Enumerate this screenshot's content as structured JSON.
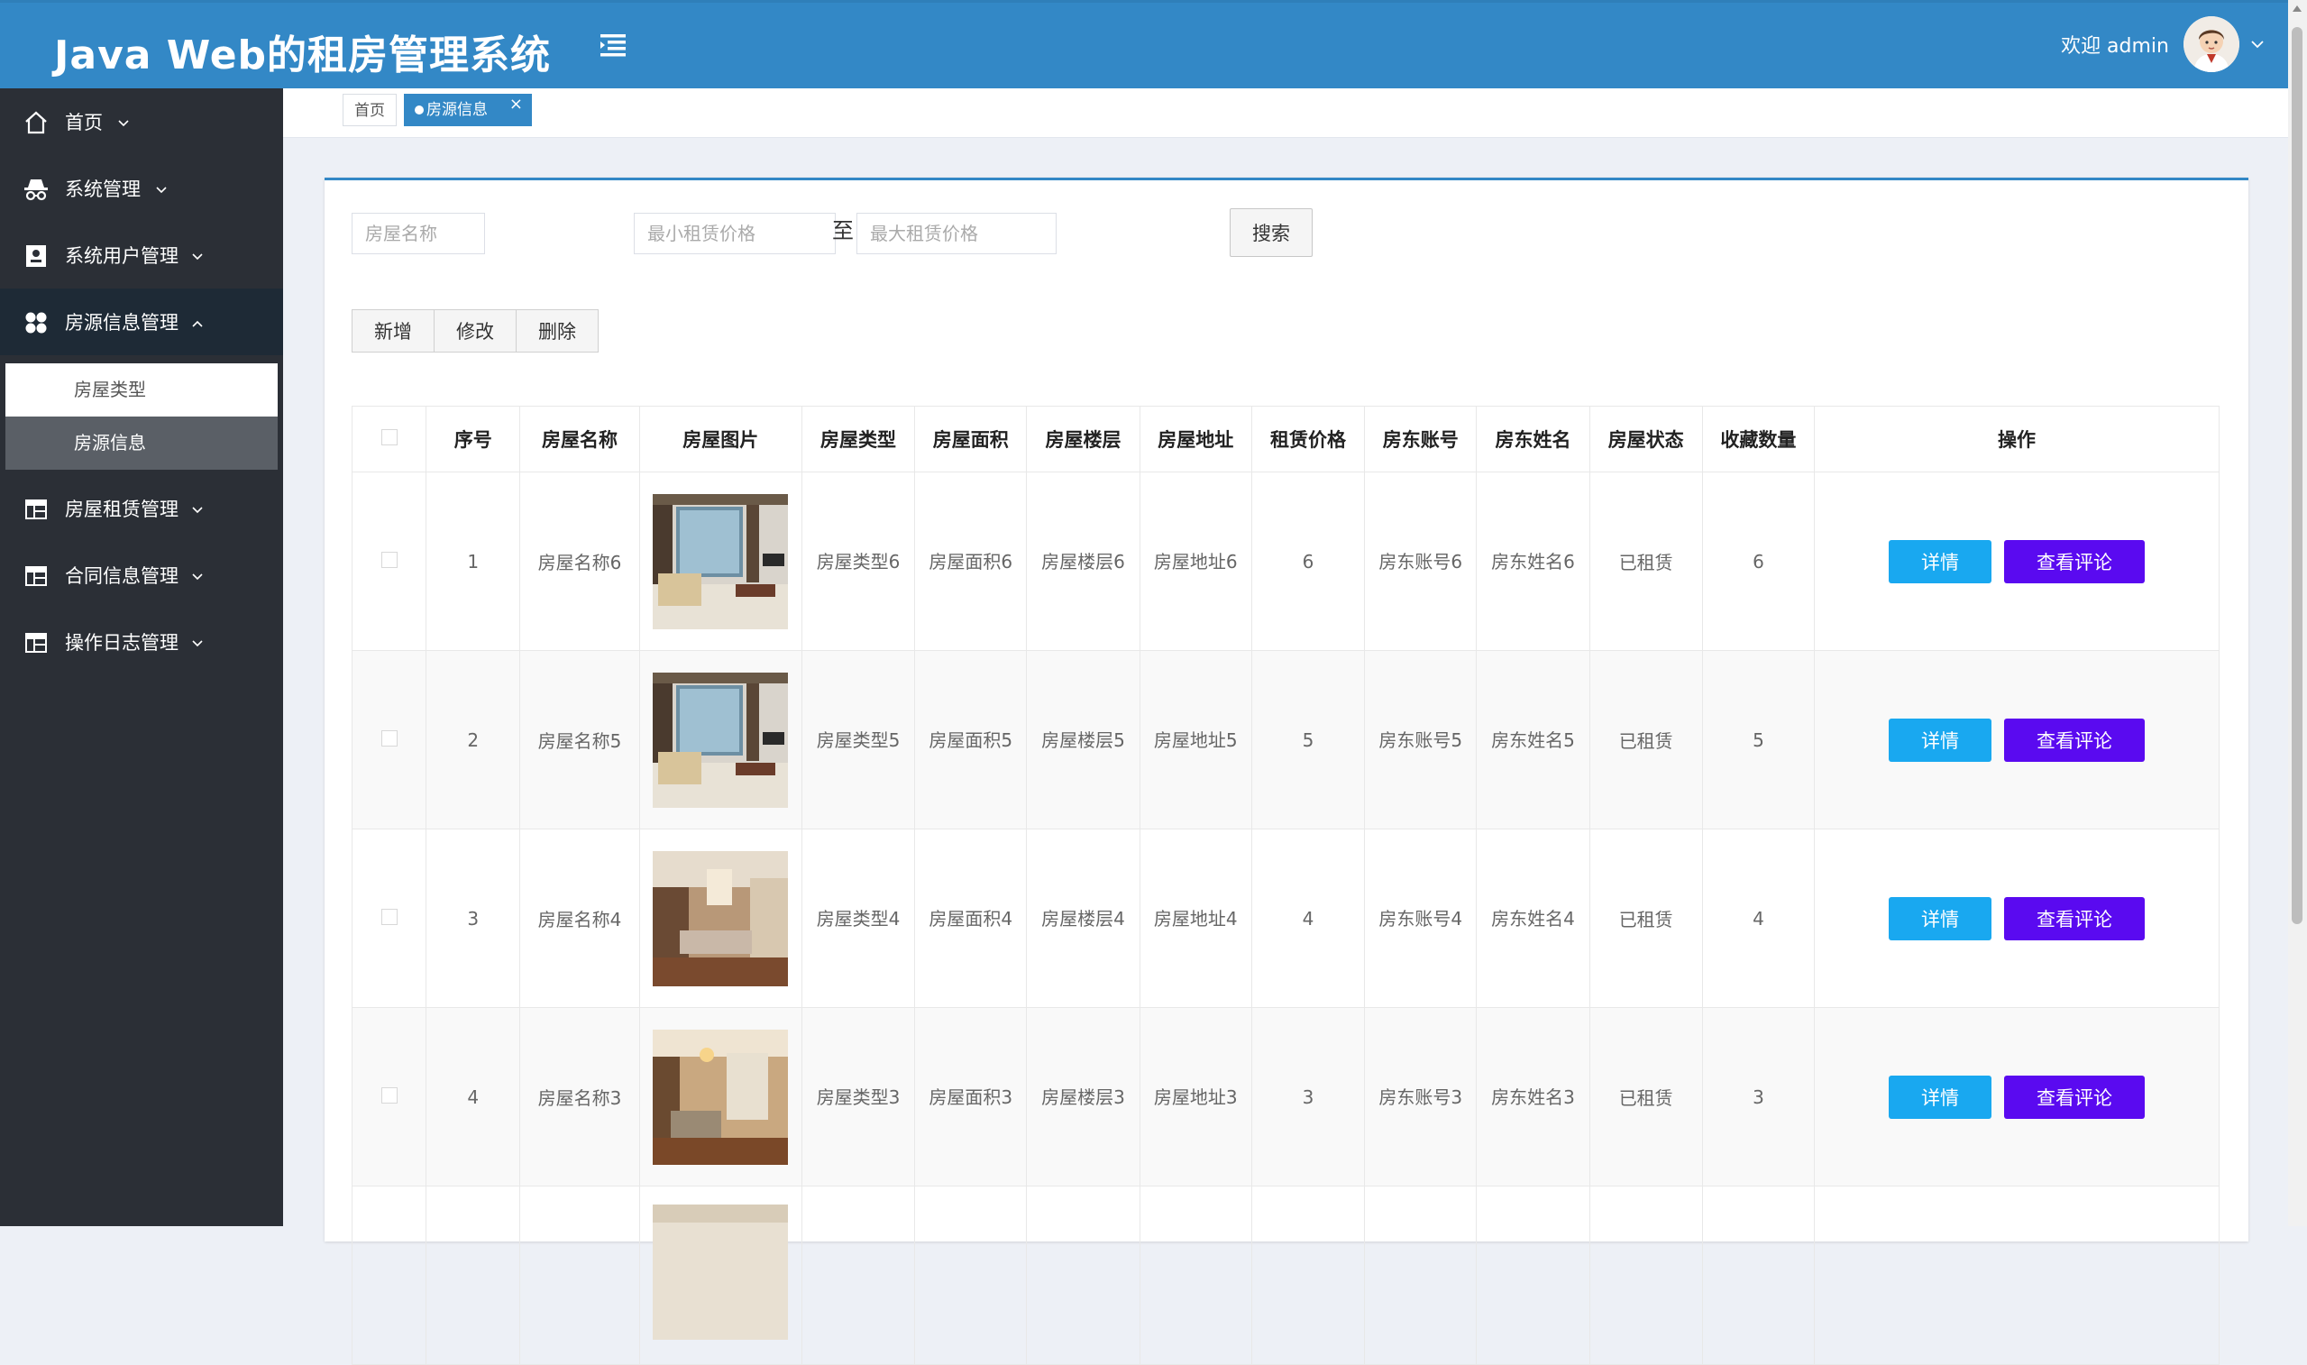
{
  "header": {
    "title": "Java Web的租房管理系统",
    "welcome": "欢迎 admin",
    "menu_toggle_icon": "menu-fold-icon",
    "avatar_icon": "user-avatar-icon"
  },
  "sidebar": {
    "items": [
      {
        "label": "首页",
        "icon": "home-icon"
      },
      {
        "label": "系统管理",
        "icon": "incognito-icon"
      },
      {
        "label": "系统用户管理",
        "icon": "contact-card-icon"
      },
      {
        "label": "房源信息管理",
        "icon": "apps-grid-icon",
        "open": true
      },
      {
        "label": "房屋租赁管理",
        "icon": "table-icon"
      },
      {
        "label": "合同信息管理",
        "icon": "table-icon"
      },
      {
        "label": "操作日志管理",
        "icon": "table-icon"
      }
    ],
    "submenu": [
      {
        "label": "房屋类型"
      },
      {
        "label": "房源信息",
        "active": true
      }
    ]
  },
  "tabs": {
    "home": "首页",
    "current": "房源信息",
    "close": "×"
  },
  "search": {
    "name_placeholder": "房屋名称",
    "min_price_placeholder": "最小租赁价格",
    "separator": "至",
    "max_price_placeholder": "最大租赁价格",
    "button": "搜索"
  },
  "actions": {
    "add": "新增",
    "edit": "修改",
    "delete": "删除"
  },
  "table": {
    "columns": [
      "序号",
      "房屋名称",
      "房屋图片",
      "房屋类型",
      "房屋面积",
      "房屋楼层",
      "房屋地址",
      "租赁价格",
      "房东账号",
      "房东姓名",
      "房屋状态",
      "收藏数量",
      "操作"
    ],
    "detail_button": "详情",
    "comment_button": "查看评论",
    "rows": [
      {
        "no": "1",
        "name": "房屋名称6",
        "type": "房屋类型6",
        "area": "房屋面积6",
        "floor": "房屋楼层6",
        "address": "房屋地址6",
        "price": "6",
        "account": "房东账号6",
        "landlord": "房东姓名6",
        "status": "已租赁",
        "favorites": "6"
      },
      {
        "no": "2",
        "name": "房屋名称5",
        "type": "房屋类型5",
        "area": "房屋面积5",
        "floor": "房屋楼层5",
        "address": "房屋地址5",
        "price": "5",
        "account": "房东账号5",
        "landlord": "房东姓名5",
        "status": "已租赁",
        "favorites": "5"
      },
      {
        "no": "3",
        "name": "房屋名称4",
        "type": "房屋类型4",
        "area": "房屋面积4",
        "floor": "房屋楼层4",
        "address": "房屋地址4",
        "price": "4",
        "account": "房东账号4",
        "landlord": "房东姓名4",
        "status": "已租赁",
        "favorites": "4"
      },
      {
        "no": "4",
        "name": "房屋名称3",
        "type": "房屋类型3",
        "area": "房屋面积3",
        "floor": "房屋楼层3",
        "address": "房屋地址3",
        "price": "3",
        "account": "房东账号3",
        "landlord": "房东姓名3",
        "status": "已租赁",
        "favorites": "3"
      }
    ]
  },
  "colors": {
    "header_bg": "#3388c6",
    "sidebar_bg": "#2b2f36",
    "detail_button": "#19a8f0",
    "comment_button": "#5a0af0"
  }
}
